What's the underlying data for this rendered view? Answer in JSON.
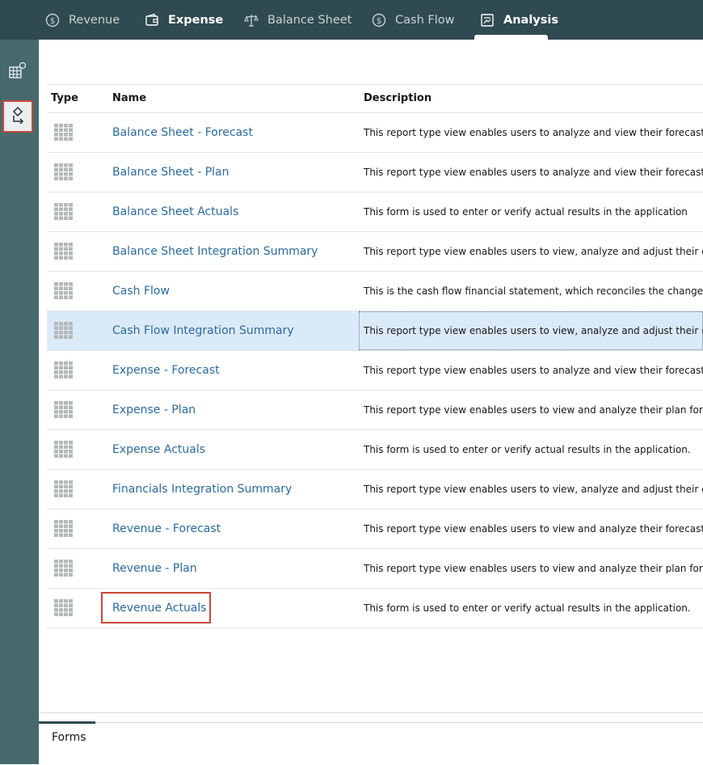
{
  "nav": {
    "tabs": [
      {
        "label": "Revenue",
        "icon": "dollar-circle-icon"
      },
      {
        "label": "Expense",
        "icon": "wallet-icon"
      },
      {
        "label": "Balance Sheet",
        "icon": "balance-scale-icon"
      },
      {
        "label": "Cash Flow",
        "icon": "dollar-circle-icon"
      },
      {
        "label": "Analysis",
        "icon": "report-icon"
      }
    ],
    "active_tab": "Analysis"
  },
  "rail": {
    "items": [
      {
        "icon": "forms-grid-icon"
      },
      {
        "icon": "tasks-flow-icon"
      }
    ]
  },
  "table": {
    "headers": {
      "type": "Type",
      "name": "Name",
      "description": "Description"
    },
    "rows": [
      {
        "name": "Balance Sheet - Forecast",
        "description": "This report type view enables users to analyze and view their forecast f..."
      },
      {
        "name": "Balance Sheet - Plan",
        "description": "This report type view enables users to analyze and view their forecast f..."
      },
      {
        "name": "Balance Sheet Actuals",
        "description": "This form is used to enter or verify actual results in the application"
      },
      {
        "name": "Balance Sheet Integration Summary",
        "description": "This report type view enables users to view, analyze and adjust their co..."
      },
      {
        "name": "Cash Flow",
        "description": "This is the cash flow financial statement, which reconciles the change i..."
      },
      {
        "name": "Cash Flow Integration Summary",
        "description": "This report type view enables users to view, analyze and adjust their co..."
      },
      {
        "name": "Expense - Forecast",
        "description": "This report type view enables users to analyze and view their forecast f..."
      },
      {
        "name": "Expense - Plan",
        "description": "This report type view enables users to view and analyze their plan for a..."
      },
      {
        "name": "Expense Actuals",
        "description": "This form is used to enter or verify actual results in the application."
      },
      {
        "name": "Financials Integration Summary",
        "description": "This report type view enables users to view, analyze and adjust their co..."
      },
      {
        "name": "Revenue - Forecast",
        "description": "This report type view enables users to view and analyze their forecast f..."
      },
      {
        "name": "Revenue - Plan",
        "description": "This report type view enables users to view and analyze their plan for a..."
      },
      {
        "name": "Revenue Actuals",
        "description": "This form is used to enter or verify actual results in the application."
      }
    ],
    "selected_row": "Cash Flow Integration Summary",
    "row_icon": "form-grid-icon"
  },
  "footer": {
    "label": "Forms"
  },
  "colors": {
    "nav_bg": "#2f4a50",
    "rail_bg": "#46696d",
    "link": "#2c6a9c",
    "selected_row": "#dbeaf9",
    "highlight": "#c8473a"
  }
}
